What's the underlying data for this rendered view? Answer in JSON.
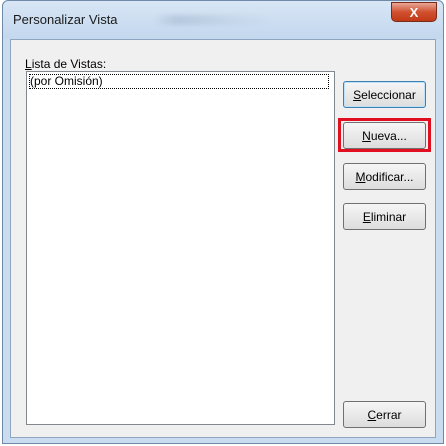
{
  "window": {
    "title": "Personalizar Vista",
    "close_glyph": "X"
  },
  "list": {
    "label_mnemonic": "L",
    "label_rest": "ista de Vistas:",
    "items": [
      "(por Omisión)"
    ]
  },
  "buttons": {
    "select": {
      "mnemonic": "S",
      "rest": "eleccionar"
    },
    "new": {
      "mnemonic": "N",
      "rest": "ueva..."
    },
    "modify": {
      "mnemonic": "M",
      "rest": "odificar..."
    },
    "delete": {
      "mnemonic": "E",
      "rest": "liminar"
    },
    "close": {
      "mnemonic": "C",
      "rest": "errar"
    }
  },
  "colors": {
    "highlight": "#e11020"
  }
}
